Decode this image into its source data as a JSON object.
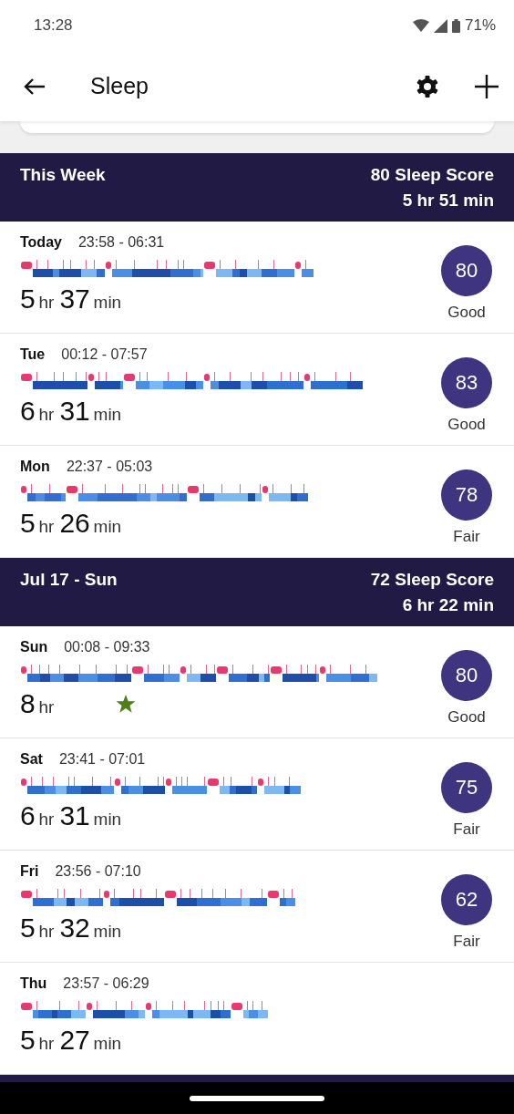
{
  "status_bar": {
    "time": "13:28",
    "battery": "71%"
  },
  "app_bar": {
    "title": "Sleep"
  },
  "weeks": [
    {
      "title": "This Week",
      "score": "80 Sleep Score",
      "duration": "5 hr 51 min",
      "nights": [
        {
          "day": "Today",
          "range": "23:58 - 06:31",
          "duration": [
            {
              "value": "5",
              "unit": "hr"
            },
            {
              "value": "37",
              "unit": "min"
            }
          ],
          "goal_met": false,
          "score": "80",
          "rating": "Good"
        },
        {
          "day": "Tue",
          "range": "00:12 - 07:57",
          "duration": [
            {
              "value": "6",
              "unit": "hr"
            },
            {
              "value": "31",
              "unit": "min"
            }
          ],
          "goal_met": false,
          "score": "83",
          "rating": "Good"
        },
        {
          "day": "Mon",
          "range": "22:37 - 05:03",
          "duration": [
            {
              "value": "5",
              "unit": "hr"
            },
            {
              "value": "26",
              "unit": "min"
            }
          ],
          "goal_met": false,
          "score": "78",
          "rating": "Fair"
        }
      ]
    },
    {
      "title": "Jul 17 - Sun",
      "score": "72 Sleep Score",
      "duration": "6 hr 22 min",
      "nights": [
        {
          "day": "Sun",
          "range": "00:08 - 09:33",
          "duration": [
            {
              "value": "8",
              "unit": "hr"
            }
          ],
          "goal_met": true,
          "score": "80",
          "rating": "Good"
        },
        {
          "day": "Sat",
          "range": "23:41 - 07:01",
          "duration": [
            {
              "value": "6",
              "unit": "hr"
            },
            {
              "value": "31",
              "unit": "min"
            }
          ],
          "goal_met": false,
          "score": "75",
          "rating": "Fair"
        },
        {
          "day": "Fri",
          "range": "23:56 - 07:10",
          "duration": [
            {
              "value": "5",
              "unit": "hr"
            },
            {
              "value": "32",
              "unit": "min"
            }
          ],
          "goal_met": false,
          "score": "62",
          "rating": "Fair"
        },
        {
          "day": "Thu",
          "range": "23:57 - 06:29",
          "duration": [
            {
              "value": "5",
              "unit": "hr"
            },
            {
              "value": "27",
              "unit": "min"
            }
          ],
          "goal_met": false
        }
      ]
    }
  ]
}
